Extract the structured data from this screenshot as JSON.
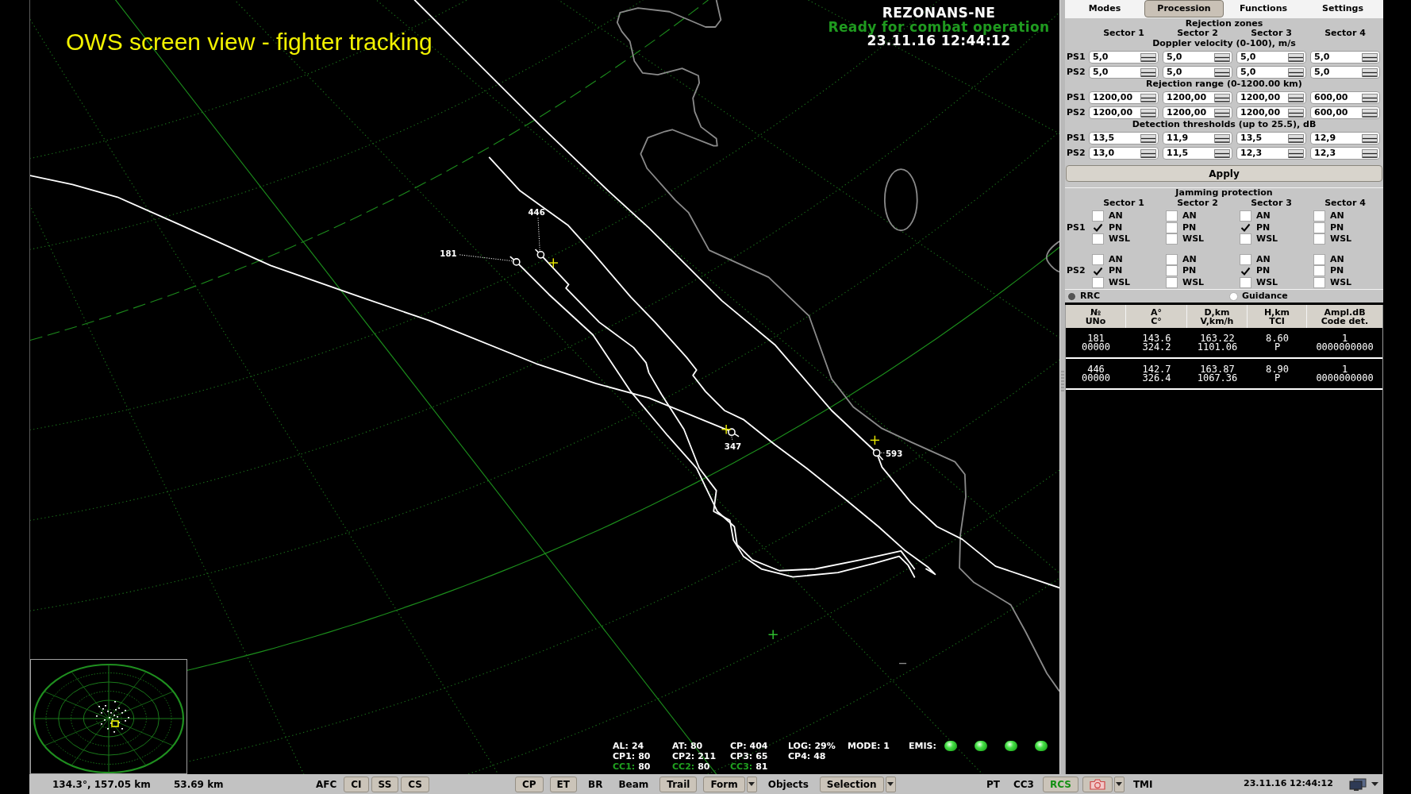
{
  "caption": "OWS screen view - fighter tracking",
  "radar": {
    "station": "REZONANS-NE",
    "status": "Ready for combat operation",
    "datetime": "23.11.16 12:44:12",
    "targets": [
      {
        "label": "181"
      },
      {
        "label": "446"
      },
      {
        "label": "347"
      },
      {
        "label": "593"
      }
    ]
  },
  "readouts": [
    [
      {
        "label": "AL:",
        "value": "24",
        "color": "#ffffff"
      },
      {
        "label": "AT:",
        "value": "80",
        "color": "#ffffff"
      },
      {
        "label": "CP:",
        "value": "404",
        "color": "#ffffff"
      },
      {
        "label": "LOG:",
        "value": "29%",
        "color": "#ffffff"
      },
      {
        "label": "MODE:",
        "value": "1",
        "color": "#ffffff"
      }
    ],
    [
      {
        "label": "CP1:",
        "value": "80",
        "color": "#ffffff"
      },
      {
        "label": "CP2:",
        "value": "211",
        "color": "#ffffff"
      },
      {
        "label": "CP3:",
        "value": "65",
        "color": "#ffffff"
      },
      {
        "label": "CP4:",
        "value": "48",
        "color": "#ffffff"
      }
    ],
    [
      {
        "label": "CC1:",
        "value": "80",
        "color": "#1fa01f"
      },
      {
        "label": "CC2:",
        "value": "80",
        "color": "#1fa01f"
      },
      {
        "label": "CC3:",
        "value": "81",
        "color": "#1fa01f"
      }
    ]
  ],
  "emis": {
    "label": "EMIS:",
    "lamps": [
      {
        "on": true
      },
      {
        "on": true
      },
      {
        "on": true
      },
      {
        "on": true
      }
    ]
  },
  "tabs": [
    {
      "label": "Modes",
      "selected": false
    },
    {
      "label": "Procession",
      "selected": true
    },
    {
      "label": "Functions",
      "selected": false
    },
    {
      "label": "Settings",
      "selected": false
    }
  ],
  "rejection_zones": {
    "title": "Rejection zones",
    "sectors": [
      "Sector 1",
      "Sector 2",
      "Sector 3",
      "Sector 4"
    ],
    "groups": [
      {
        "title": "Doppler velocity (0-100), m/s",
        "rows": [
          {
            "label": "PS1",
            "values": [
              "5,0",
              "5,0",
              "5,0",
              "5,0"
            ]
          },
          {
            "label": "PS2",
            "values": [
              "5,0",
              "5,0",
              "5,0",
              "5,0"
            ]
          }
        ]
      },
      {
        "title": "Rejection range (0-1200.00 km)",
        "rows": [
          {
            "label": "PS1",
            "values": [
              "1200,00",
              "1200,00",
              "1200,00",
              "600,00"
            ]
          },
          {
            "label": "PS2",
            "values": [
              "1200,00",
              "1200,00",
              "1200,00",
              "600,00"
            ]
          }
        ]
      },
      {
        "title": "Detection thresholds (up to 25.5), dB",
        "rows": [
          {
            "label": "PS1",
            "values": [
              "13,5",
              "11,9",
              "13,5",
              "12,9"
            ]
          },
          {
            "label": "PS2",
            "values": [
              "13,0",
              "11,5",
              "12,3",
              "12,3"
            ]
          }
        ]
      }
    ]
  },
  "apply_button": "Apply",
  "jamming_protection": {
    "title": "Jamming protection",
    "sectors": [
      "Sector 1",
      "Sector 2",
      "Sector 3",
      "Sector 4"
    ],
    "groups": [
      {
        "label": "PS1",
        "sectors": [
          {
            "options": [
              {
                "label": "AN",
                "checked": false
              },
              {
                "label": "PN",
                "checked": true
              },
              {
                "label": "WSL",
                "checked": false
              }
            ]
          },
          {
            "options": [
              {
                "label": "AN",
                "checked": false
              },
              {
                "label": "PN",
                "checked": false
              },
              {
                "label": "WSL",
                "checked": false
              }
            ]
          },
          {
            "options": [
              {
                "label": "AN",
                "checked": false
              },
              {
                "label": "PN",
                "checked": true
              },
              {
                "label": "WSL",
                "checked": false
              }
            ]
          },
          {
            "options": [
              {
                "label": "AN",
                "checked": false
              },
              {
                "label": "PN",
                "checked": false
              },
              {
                "label": "WSL",
                "checked": false
              }
            ]
          }
        ]
      },
      {
        "label": "PS2",
        "sectors": [
          {
            "options": [
              {
                "label": "AN",
                "checked": false
              },
              {
                "label": "PN",
                "checked": true
              },
              {
                "label": "WSL",
                "checked": false
              }
            ]
          },
          {
            "options": [
              {
                "label": "AN",
                "checked": false
              },
              {
                "label": "PN",
                "checked": false
              },
              {
                "label": "WSL",
                "checked": false
              }
            ]
          },
          {
            "options": [
              {
                "label": "AN",
                "checked": false
              },
              {
                "label": "PN",
                "checked": true
              },
              {
                "label": "WSL",
                "checked": false
              }
            ]
          },
          {
            "options": [
              {
                "label": "AN",
                "checked": false
              },
              {
                "label": "PN",
                "checked": false
              },
              {
                "label": "WSL",
                "checked": false
              }
            ]
          }
        ]
      }
    ]
  },
  "guidance_mode": [
    {
      "label": "RRC",
      "selected": true
    },
    {
      "label": "Guidance",
      "selected": false
    }
  ],
  "targets_table": {
    "header_lines": [
      [
        "№",
        "A°",
        "D,km",
        "H,km",
        "Ampl.dB"
      ],
      [
        "UNo",
        "C°",
        "V,km/h",
        "TCI",
        "Code det."
      ]
    ],
    "tracks": [
      {
        "lines": [
          [
            "181",
            "143.6",
            "163.22",
            "8.60",
            "1"
          ],
          [
            "00000",
            "324.2",
            "1101.06",
            "P",
            "0000000000"
          ]
        ]
      },
      {
        "lines": [
          [
            "446",
            "142.7",
            "163.87",
            "8.90",
            "1"
          ],
          [
            "00000",
            "326.4",
            "1067.36",
            "P",
            "0000000000"
          ]
        ]
      }
    ]
  },
  "status_bar": {
    "cursor": "134.3°, 157.05 km",
    "range": "53.69 km",
    "groups": [
      {
        "items": [
          {
            "kind": "label",
            "text": "AFC"
          },
          {
            "kind": "button",
            "text": "CI",
            "active": false
          },
          {
            "kind": "button",
            "text": "SS",
            "active": false
          },
          {
            "kind": "button",
            "text": "CS",
            "active": false
          }
        ]
      },
      {
        "items": [
          {
            "kind": "button",
            "text": "CP",
            "active": false
          },
          {
            "kind": "button",
            "text": "ET",
            "active": false
          },
          {
            "kind": "label",
            "text": "BR"
          },
          {
            "kind": "label",
            "text": "Beam"
          },
          {
            "kind": "button",
            "text": "Trail",
            "active": false
          },
          {
            "kind": "menu_button",
            "text": "Form",
            "active": false
          },
          {
            "kind": "label",
            "text": "Objects"
          },
          {
            "kind": "menu_button",
            "text": "Selection",
            "active": false
          }
        ]
      },
      {
        "items": [
          {
            "kind": "label",
            "text": "PT"
          },
          {
            "kind": "label",
            "text": "CC3"
          },
          {
            "kind": "button",
            "text": "RCS",
            "active": true
          },
          {
            "kind": "camera_menu"
          },
          {
            "kind": "label",
            "text": "TMI"
          }
        ]
      }
    ],
    "datetime": "23.11.16 12:44:12"
  }
}
